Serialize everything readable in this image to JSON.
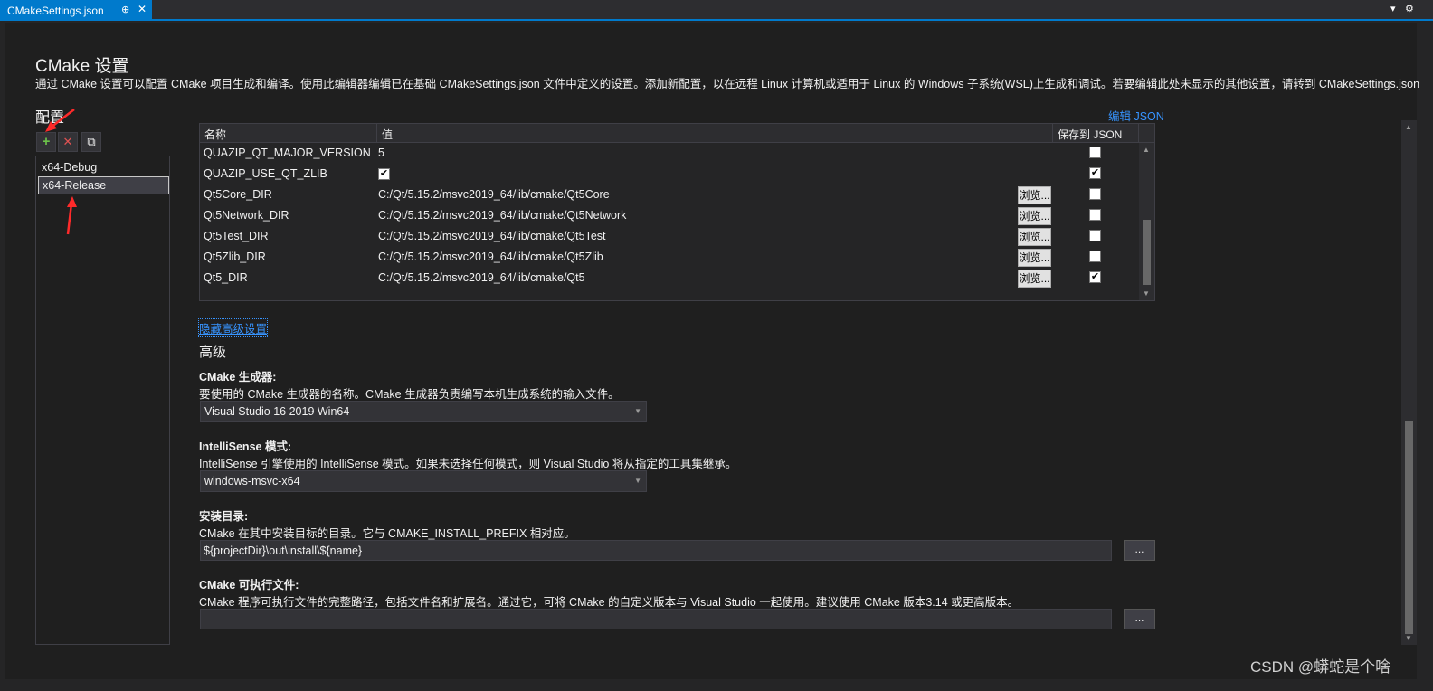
{
  "tab": {
    "title": "CMakeSettings.json",
    "pin": "⊕",
    "close": "✕"
  },
  "tab_right": {
    "dropdown": "▾",
    "gear": "⚙"
  },
  "page": {
    "title": "CMake 设置",
    "description": "通过 CMake 设置可以配置 CMake 项目生成和编译。使用此编辑器编辑已在基础 CMakeSettings.json 文件中定义的设置。添加新配置，以在远程 Linux 计算机或适用于 Linux 的 Windows 子系统(WSL)上生成和调试。若要编辑此处未显示的其他设置，请转到 CMakeSettings.json"
  },
  "config": {
    "heading": "配置",
    "toolbar": {
      "add": "+",
      "remove": "✕",
      "copy": "⧉"
    },
    "items": [
      "x64-Debug",
      "x64-Release"
    ],
    "selected": "x64-Release"
  },
  "edit_json_link": "编辑 JSON",
  "grid": {
    "columns": [
      "名称",
      "值",
      "保存到 JSON"
    ],
    "browse_label": "浏览...",
    "rows": [
      {
        "name": "QUAZIP_QT_MAJOR_VERSION",
        "value": "5",
        "value_checkbox": false,
        "browse": false,
        "save": false
      },
      {
        "name": "QUAZIP_USE_QT_ZLIB",
        "value": "",
        "value_checkbox": true,
        "browse": false,
        "save": true
      },
      {
        "name": "Qt5Core_DIR",
        "value": "C:/Qt/5.15.2/msvc2019_64/lib/cmake/Qt5Core",
        "value_checkbox": false,
        "browse": true,
        "save": false
      },
      {
        "name": "Qt5Network_DIR",
        "value": "C:/Qt/5.15.2/msvc2019_64/lib/cmake/Qt5Network",
        "value_checkbox": false,
        "browse": true,
        "save": false
      },
      {
        "name": "Qt5Test_DIR",
        "value": "C:/Qt/5.15.2/msvc2019_64/lib/cmake/Qt5Test",
        "value_checkbox": false,
        "browse": true,
        "save": false
      },
      {
        "name": "Qt5Zlib_DIR",
        "value": "C:/Qt/5.15.2/msvc2019_64/lib/cmake/Qt5Zlib",
        "value_checkbox": false,
        "browse": true,
        "save": false
      },
      {
        "name": "Qt5_DIR",
        "value": "C:/Qt/5.15.2/msvc2019_64/lib/cmake/Qt5",
        "value_checkbox": false,
        "browse": true,
        "save": true
      }
    ]
  },
  "hide_advanced_link": "隐藏高级设置",
  "advanced": {
    "heading": "高级",
    "generator": {
      "label": "CMake 生成器:",
      "desc": "要使用的 CMake 生成器的名称。CMake 生成器负责编写本机生成系统的输入文件。",
      "value": "Visual Studio 16 2019 Win64"
    },
    "intellisense": {
      "label": "IntelliSense 模式:",
      "desc": "IntelliSense 引擎使用的 IntelliSense 模式。如果未选择任何模式，则 Visual Studio 将从指定的工具集继承。",
      "value": "windows-msvc-x64"
    },
    "install_dir": {
      "label": "安装目录:",
      "desc": "CMake 在其中安装目标的目录。它与 CMAKE_INSTALL_PREFIX 相对应。",
      "value": "${projectDir}\\out\\install\\${name}",
      "button": "..."
    },
    "cmake_exe": {
      "label": "CMake 可执行文件:",
      "desc": "CMake 程序可执行文件的完整路径，包括文件名和扩展名。通过它，可将 CMake 的自定义版本与 Visual Studio 一起使用。建议使用 CMake 版本3.14 或更高版本。",
      "value": "",
      "button": "..."
    }
  },
  "watermark": "CSDN @蟒蛇是个啥",
  "colors": {
    "accent": "#007acc",
    "link": "#3794ff",
    "annotation": "#ff2a2a"
  }
}
